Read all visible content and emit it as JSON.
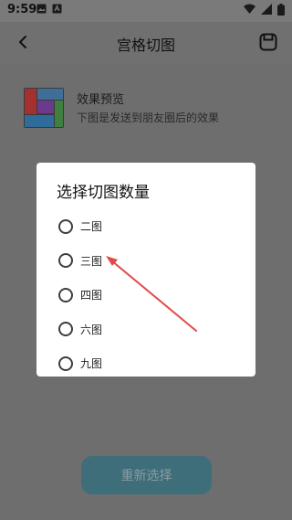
{
  "status_bar": {
    "time": "9:59",
    "left_icons": [
      "image-icon",
      "app-icon"
    ],
    "right_icons": [
      "wifi-icon",
      "signal-icon",
      "battery-icon"
    ]
  },
  "header": {
    "title": "宫格切图",
    "back_icon": "back-arrow-icon",
    "save_icon": "save-icon"
  },
  "preview": {
    "title": "效果预览",
    "subtitle": "下图是发送到朋友圈后的效果"
  },
  "dialog": {
    "title": "选择切图数量",
    "options": [
      {
        "label": "二图"
      },
      {
        "label": "三图"
      },
      {
        "label": "四图"
      },
      {
        "label": "六图"
      },
      {
        "label": "九图"
      }
    ]
  },
  "bottom_button": {
    "label": "重新选择"
  },
  "colors": {
    "overlay_dim": "#707070",
    "dialog_bg": "#ffffff",
    "arrow_red": "#e24a4a",
    "button_teal": "#3f6e7b"
  }
}
